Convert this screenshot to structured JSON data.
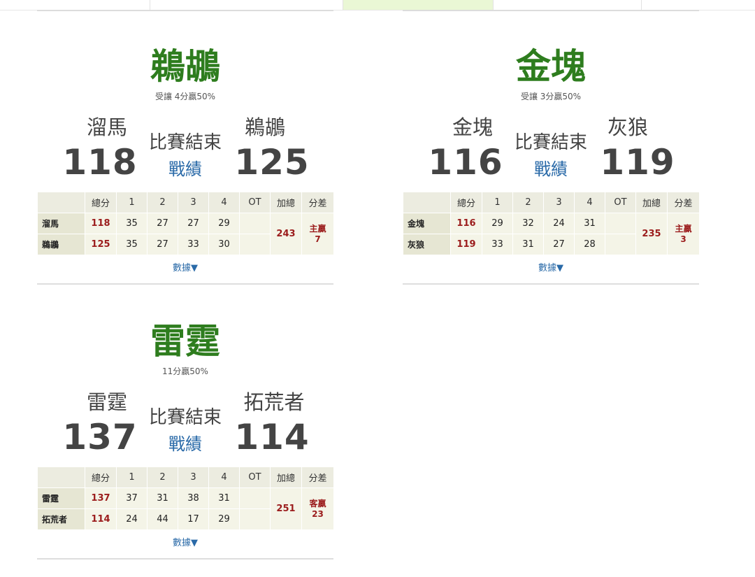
{
  "games": [
    {
      "title": "鵜鶘",
      "subtitle": "受讓 4分贏50%",
      "home": {
        "name": "溜馬",
        "score": "118"
      },
      "away": {
        "name": "鵜鶘",
        "score": "125"
      },
      "status": "比賽結束",
      "record_link": "戰績",
      "table": {
        "headers": [
          "總分",
          "1",
          "2",
          "3",
          "4",
          "OT",
          "加總",
          "分差"
        ],
        "rows": [
          {
            "team": "溜馬",
            "total": "118",
            "q": [
              "35",
              "27",
              "27",
              "29"
            ],
            "ot": ""
          },
          {
            "team": "鵜鶘",
            "total": "125",
            "q": [
              "35",
              "27",
              "33",
              "30"
            ],
            "ot": ""
          }
        ],
        "sum": "243",
        "diff": [
          "主贏",
          "7"
        ]
      },
      "data_link": "數據▼"
    },
    {
      "title": "金塊",
      "subtitle": "受讓 3分贏50%",
      "home": {
        "name": "金塊",
        "score": "116"
      },
      "away": {
        "name": "灰狼",
        "score": "119"
      },
      "status": "比賽結束",
      "record_link": "戰績",
      "table": {
        "headers": [
          "總分",
          "1",
          "2",
          "3",
          "4",
          "OT",
          "加總",
          "分差"
        ],
        "rows": [
          {
            "team": "金塊",
            "total": "116",
            "q": [
              "29",
              "32",
              "24",
              "31"
            ],
            "ot": ""
          },
          {
            "team": "灰狼",
            "total": "119",
            "q": [
              "33",
              "31",
              "27",
              "28"
            ],
            "ot": ""
          }
        ],
        "sum": "235",
        "diff": [
          "主贏",
          "3"
        ]
      },
      "data_link": "數據▼"
    },
    {
      "title": "雷霆",
      "subtitle": "11分贏50%",
      "home": {
        "name": "雷霆",
        "score": "137"
      },
      "away": {
        "name": "拓荒者",
        "score": "114"
      },
      "status": "比賽結束",
      "record_link": "戰績",
      "table": {
        "headers": [
          "總分",
          "1",
          "2",
          "3",
          "4",
          "OT",
          "加總",
          "分差"
        ],
        "rows": [
          {
            "team": "雷霆",
            "total": "137",
            "q": [
              "37",
              "31",
              "38",
              "31"
            ],
            "ot": ""
          },
          {
            "team": "拓荒者",
            "total": "114",
            "q": [
              "24",
              "44",
              "17",
              "29"
            ],
            "ot": ""
          }
        ],
        "sum": "251",
        "diff": [
          "客贏",
          "23"
        ]
      },
      "data_link": "數據▼"
    }
  ]
}
